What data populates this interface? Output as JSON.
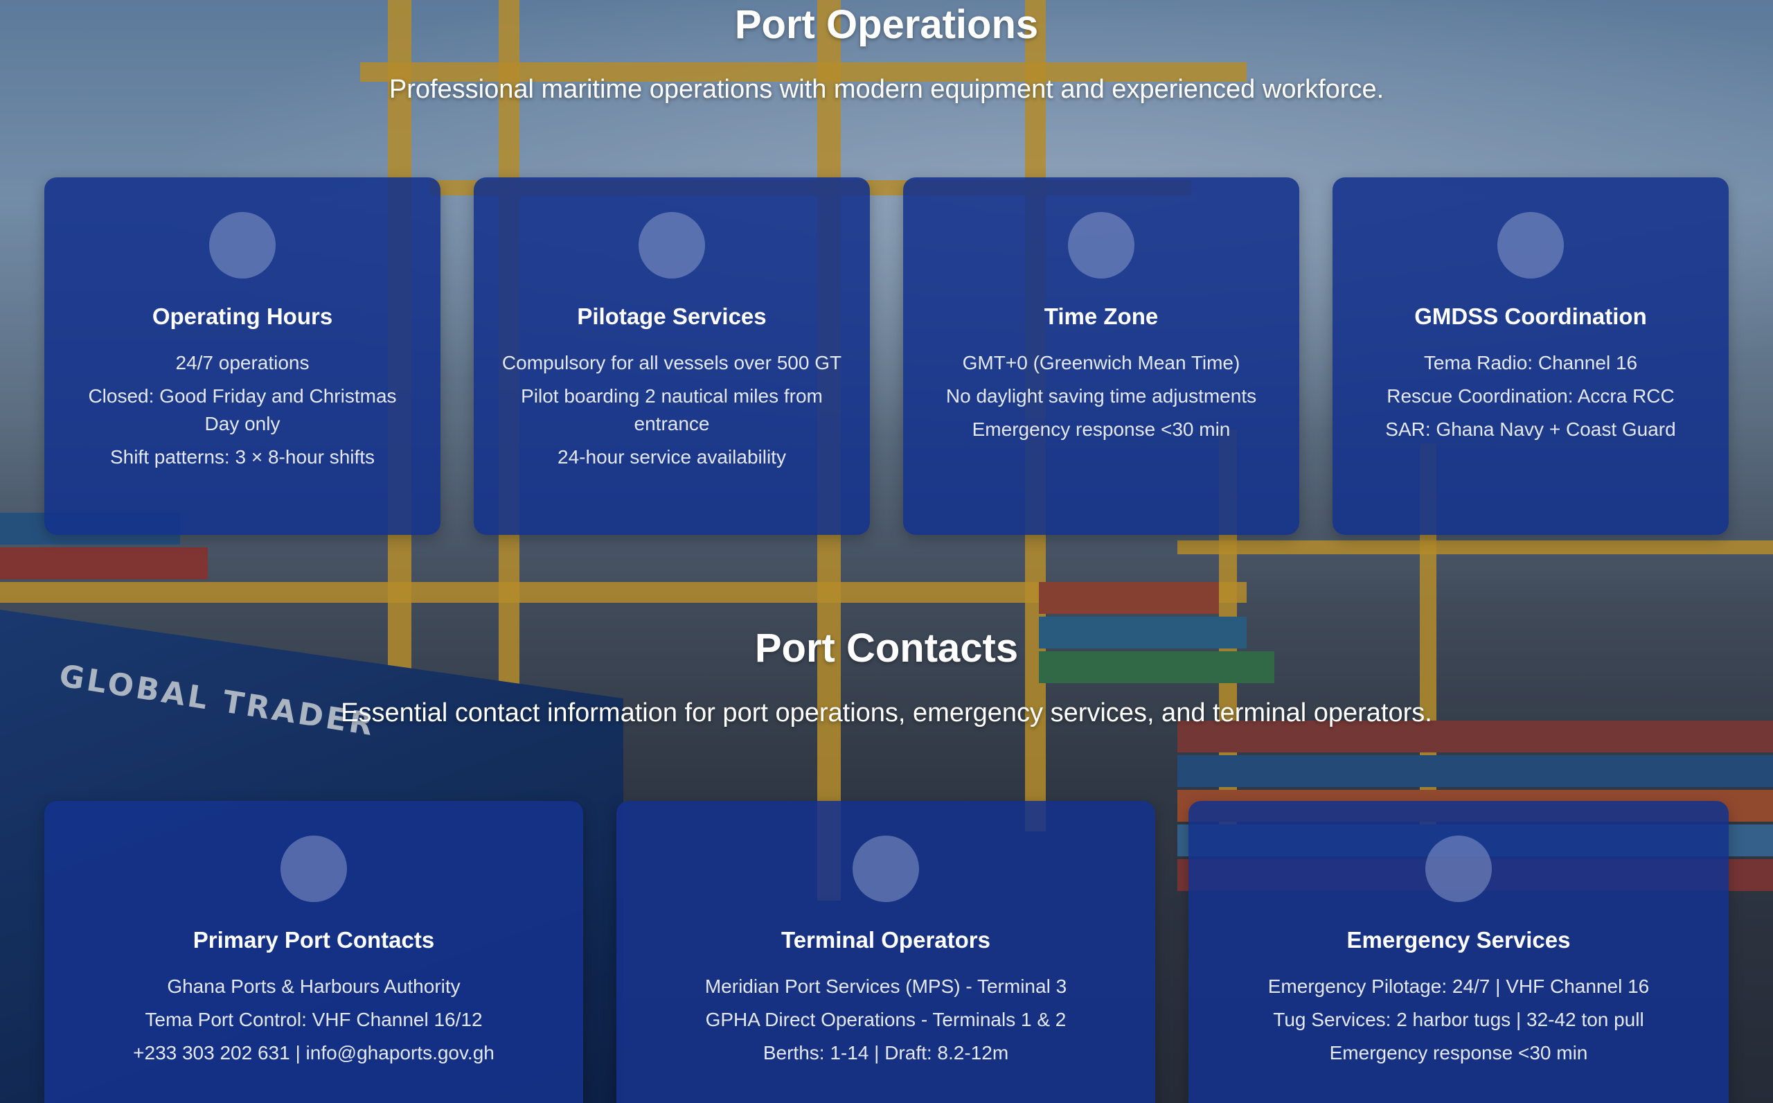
{
  "operations": {
    "title": "Port Operations",
    "subtitle": "Professional maritime operations with modern equipment and experienced workforce.",
    "cards": [
      {
        "icon": "clock-icon",
        "title": "Operating Hours",
        "lines": [
          "24/7 operations",
          "Closed: Good Friday and Christmas Day only",
          "Shift patterns: 3 × 8-hour shifts"
        ]
      },
      {
        "icon": "pilot-icon",
        "title": "Pilotage Services",
        "lines": [
          "Compulsory for all vessels over 500 GT",
          "Pilot boarding 2 nautical miles from entrance",
          "24-hour service availability"
        ]
      },
      {
        "icon": "globe-icon",
        "title": "Time Zone",
        "lines": [
          "GMT+0 (Greenwich Mean Time)",
          "No daylight saving time adjustments",
          "Emergency response <30 min"
        ]
      },
      {
        "icon": "radio-icon",
        "title": "GMDSS Coordination",
        "lines": [
          "Tema Radio: Channel 16",
          "Rescue Coordination: Accra RCC",
          "SAR: Ghana Navy + Coast Guard"
        ]
      }
    ]
  },
  "contacts": {
    "title": "Port Contacts",
    "subtitle": "Essential contact information for port operations, emergency services, and terminal operators.",
    "cards": [
      {
        "icon": "building-icon",
        "title": "Primary Port Contacts",
        "lines": [
          "Ghana Ports & Harbours Authority",
          "Tema Port Control: VHF Channel 16/12",
          "+233 303 202 631 | info@ghaports.gov.gh"
        ]
      },
      {
        "icon": "terminal-icon",
        "title": "Terminal Operators",
        "lines": [
          "Meridian Port Services (MPS) - Terminal 3",
          "GPHA Direct Operations - Terminals 1 & 2",
          "Berths: 1-14 | Draft: 8.2-12m"
        ]
      },
      {
        "icon": "emergency-icon",
        "title": "Emergency Services",
        "lines": [
          "Emergency Pilotage: 24/7 | VHF Channel 16",
          "Tug Services: 2 harbor tugs | 32-42 ton pull",
          "Emergency response <30 min"
        ]
      }
    ]
  },
  "background": {
    "ship_name": "GLOBAL TRADER"
  }
}
